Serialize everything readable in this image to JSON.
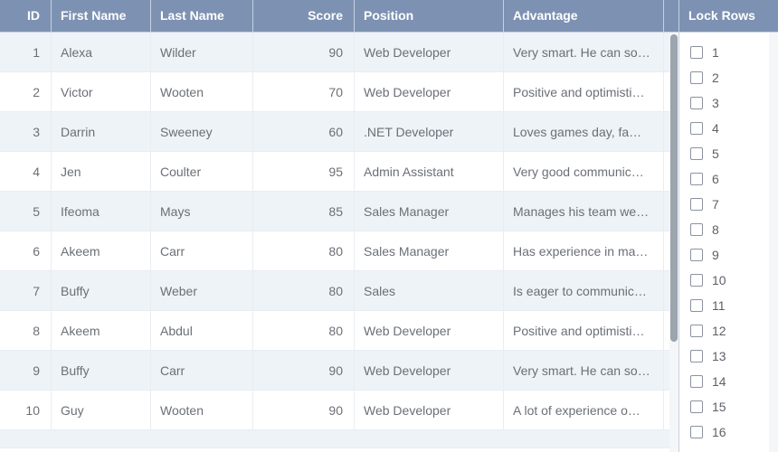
{
  "columns": {
    "id": "ID",
    "first": "First Name",
    "last": "Last Name",
    "score": "Score",
    "pos": "Position",
    "adv": "Advantage"
  },
  "rows": [
    {
      "id": "1",
      "first": "Alexa",
      "last": "Wilder",
      "score": "90",
      "pos": "Web Developer",
      "adv": "Very smart. He can so…"
    },
    {
      "id": "2",
      "first": "Victor",
      "last": "Wooten",
      "score": "70",
      "pos": "Web Developer",
      "adv": "Positive and optimisti…"
    },
    {
      "id": "3",
      "first": "Darrin",
      "last": "Sweeney",
      "score": "60",
      "pos": ".NET Developer",
      "adv": "Loves games day, fa…"
    },
    {
      "id": "4",
      "first": "Jen",
      "last": "Coulter",
      "score": "95",
      "pos": "Admin Assistant",
      "adv": "Very good communic…"
    },
    {
      "id": "5",
      "first": "Ifeoma",
      "last": "Mays",
      "score": "85",
      "pos": "Sales Manager",
      "adv": "Manages his team we…"
    },
    {
      "id": "6",
      "first": "Akeem",
      "last": "Carr",
      "score": "80",
      "pos": "Sales Manager",
      "adv": "Has experience in ma…"
    },
    {
      "id": "7",
      "first": "Buffy",
      "last": "Weber",
      "score": "80",
      "pos": "Sales",
      "adv": "Is eager to communic…"
    },
    {
      "id": "8",
      "first": "Akeem",
      "last": "Abdul",
      "score": "80",
      "pos": "Web Developer",
      "adv": "Positive and optimisti…"
    },
    {
      "id": "9",
      "first": "Buffy",
      "last": "Carr",
      "score": "90",
      "pos": "Web Developer",
      "adv": "Very smart. He can so…"
    },
    {
      "id": "10",
      "first": "Guy",
      "last": "Wooten",
      "score": "90",
      "pos": "Web Developer",
      "adv": "A lot of experience o…"
    }
  ],
  "side": {
    "header": "Lock Rows",
    "items": [
      "1",
      "2",
      "3",
      "4",
      "5",
      "6",
      "7",
      "8",
      "9",
      "10",
      "11",
      "12",
      "13",
      "14",
      "15",
      "16"
    ]
  }
}
